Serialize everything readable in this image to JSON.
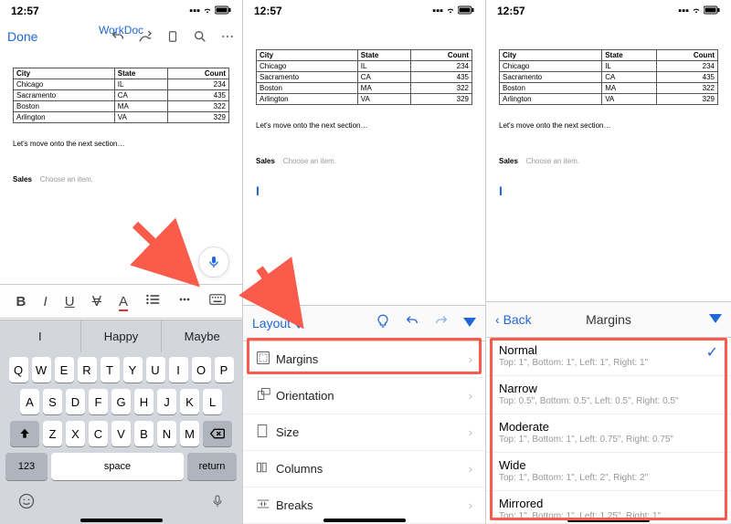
{
  "status": {
    "time": "12:57"
  },
  "header": {
    "done": "Done",
    "title": "WorkDoc"
  },
  "table": {
    "headers": [
      "City",
      "State",
      "Count"
    ],
    "rows": [
      [
        "Chicago",
        "IL",
        "234"
      ],
      [
        "Sacramento",
        "CA",
        "435"
      ],
      [
        "Boston",
        "MA",
        "322"
      ],
      [
        "Arlington",
        "VA",
        "329"
      ]
    ]
  },
  "body": {
    "nextline": "Let's move onto the next section…",
    "sales_label": "Sales",
    "sales_hint": "Choose an item."
  },
  "suggest": [
    "I",
    "Happy",
    "Maybe"
  ],
  "kbd": {
    "r1": [
      "Q",
      "W",
      "E",
      "R",
      "T",
      "Y",
      "U",
      "I",
      "O",
      "P"
    ],
    "r2": [
      "A",
      "S",
      "D",
      "F",
      "G",
      "H",
      "J",
      "K",
      "L"
    ],
    "r3": [
      "Z",
      "X",
      "C",
      "V",
      "B",
      "N",
      "M"
    ],
    "num": "123",
    "space": "space",
    "return": "return"
  },
  "layout": {
    "tab_label": "Layout",
    "items": [
      {
        "icon": "margins-icon",
        "label": "Margins"
      },
      {
        "icon": "orientation-icon",
        "label": "Orientation"
      },
      {
        "icon": "size-icon",
        "label": "Size"
      },
      {
        "icon": "columns-icon",
        "label": "Columns"
      },
      {
        "icon": "breaks-icon",
        "label": "Breaks"
      }
    ]
  },
  "margins": {
    "back": "Back",
    "title": "Margins",
    "options": [
      {
        "name": "Normal",
        "desc": "Top: 1\", Bottom: 1\", Left: 1\", Right: 1\"",
        "selected": true
      },
      {
        "name": "Narrow",
        "desc": "Top: 0.5\", Bottom: 0.5\", Left: 0.5\", Right: 0.5\""
      },
      {
        "name": "Moderate",
        "desc": "Top: 1\", Bottom: 1\", Left: 0.75\", Right: 0.75\""
      },
      {
        "name": "Wide",
        "desc": "Top: 1\", Bottom: 1\", Left: 2\", Right: 2\""
      },
      {
        "name": "Mirrored",
        "desc": "Top: 1\", Bottom: 1\", Left: 1.25\", Right: 1\""
      }
    ]
  }
}
